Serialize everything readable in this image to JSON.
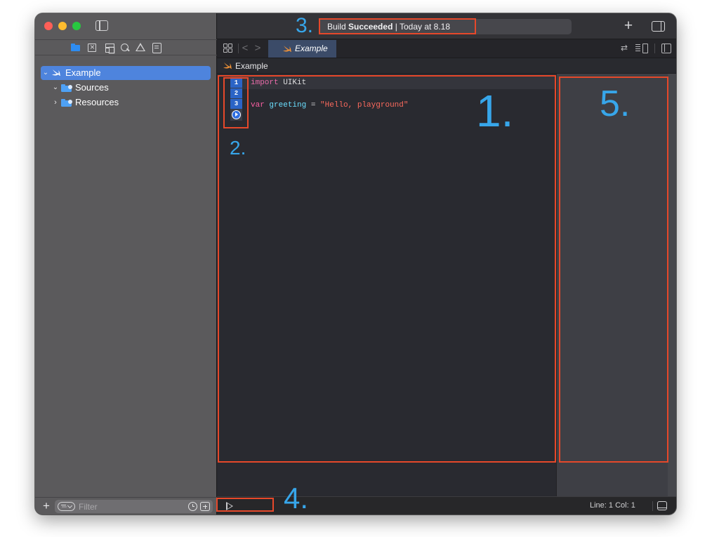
{
  "sidebar": {
    "nav_icons": [
      "folder-icon",
      "source-control-icon",
      "symbol-icon",
      "find-icon",
      "issue-warning-icon",
      "report-icon"
    ],
    "tree": [
      {
        "label": "Example",
        "icon": "swift-icon",
        "expanded": true,
        "selected": true
      },
      {
        "label": "Sources",
        "icon": "folder-icon",
        "expanded": true
      },
      {
        "label": "Resources",
        "icon": "folder-icon",
        "expanded": false
      }
    ],
    "filter_placeholder": "Filter",
    "add_symbol": "+"
  },
  "toolbar": {
    "activity_prefix": "Build ",
    "activity_status": "Succeeded",
    "activity_suffix": " | Today at 8.18",
    "add_symbol": "+"
  },
  "tabbar": {
    "tab_label": "Example",
    "back_symbol": "<",
    "forward_symbol": ">",
    "swap_symbol": "⇄"
  },
  "jumpbar": {
    "path": "Example"
  },
  "editor": {
    "line_numbers": [
      "1",
      "2",
      "3"
    ],
    "code": {
      "line1_keyword": "import",
      "line1_module": " UIKit",
      "line3_keyword": "var",
      "line3_name": " greeting",
      "line3_op": " = ",
      "line3_string": "\"Hello, playground\""
    }
  },
  "statusbar": {
    "position": "Line: 1  Col: 1"
  },
  "annotations": {
    "n1": "1.",
    "n2": "2.",
    "n3": "3.",
    "n4": "4.",
    "n5": "5."
  },
  "colors": {
    "annotation_box": "#e6482a",
    "annotation_number": "#37a6ea",
    "selection": "#4e84dd",
    "keyword": "#fc5fa3",
    "string": "#fc6a5d"
  }
}
